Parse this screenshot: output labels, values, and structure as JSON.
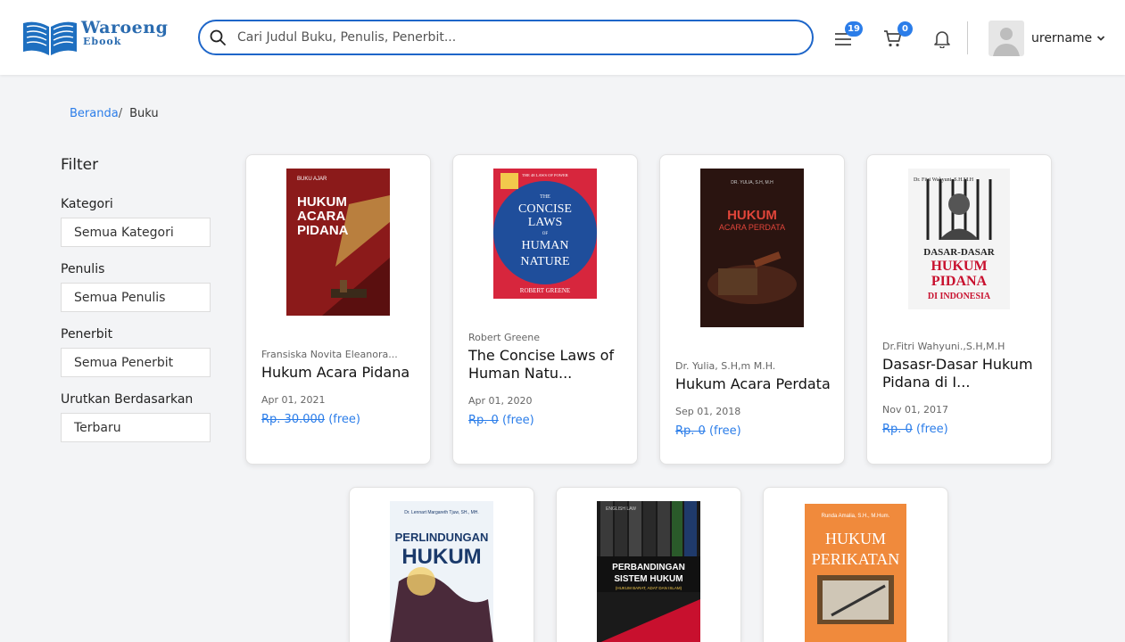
{
  "header": {
    "logo_line1": "Waroeng",
    "logo_line2": "Ebook",
    "search_placeholder": "Cari Judul Buku, Penulis, Penerbit...",
    "list_badge": "19",
    "cart_badge": "0",
    "username": "urername"
  },
  "breadcrumb": {
    "home": "Beranda",
    "separator": "/",
    "current": "Buku"
  },
  "filter": {
    "title": "Filter",
    "category_label": "Kategori",
    "category_value": "Semua Kategori",
    "author_label": "Penulis",
    "author_value": "Semua Penulis",
    "publisher_label": "Penerbit",
    "publisher_value": "Semua Penerbit",
    "sort_label": "Urutkan Berdasarkan",
    "sort_value": "Terbaru"
  },
  "books": [
    {
      "author": "Fransiska Novita Eleanora...",
      "title": "Hukum Acara Pidana",
      "date": "Apr 01, 2021",
      "price_old": "Rp. 30.000",
      "price_new": "(free)",
      "cover": {
        "bg": "#8b1a1a",
        "accent": "#c8a24b",
        "fg": "#ffffff",
        "top": "BUKU AJAR",
        "lines": [
          "HUKUM",
          "ACARA",
          "PIDANA"
        ]
      }
    },
    {
      "author": "Robert Greene",
      "title": "The Concise Laws of Human Natu...",
      "date": "Apr 01, 2020",
      "price_old": "Rp. 0",
      "price_new": "(free)",
      "cover": {
        "bg": "#d7263d",
        "accent": "#1f4e9b",
        "fg": "#ffffff",
        "top": "THE 48 LAWS OF POWER",
        "lines": [
          "THE",
          "CONCISE",
          "LAWS",
          "OF",
          "HUMAN",
          "NATURE"
        ],
        "bottom": "ROBERT GREENE"
      }
    },
    {
      "author": "Dr. Yulia, S.H,m M.H.",
      "title": "Hukum Acara Perdata",
      "date": "Sep 01, 2018",
      "price_old": "Rp. 0",
      "price_new": "(free)",
      "cover": {
        "bg": "#2a1410",
        "accent": "#b23a2a",
        "fg": "#e0453a",
        "top": "DR. YULIA, S.H, M.H",
        "lines": [
          "HUKUM",
          "ACARA PERDATA"
        ]
      }
    },
    {
      "author": "Dr.Fitri Wahyuni.,S.H,M.H",
      "title": "Dasasr-Dasar Hukum Pidana di I...",
      "date": "Nov 01, 2017",
      "price_old": "Rp. 0",
      "price_new": "(free)",
      "cover": {
        "bg": "#f4f4f4",
        "accent": "#222222",
        "fg": "#c8102e",
        "top": "Dr. Fitri Wahyuni, S.H.M.H",
        "lines": [
          "DASAR-DASAR",
          "HUKUM",
          "PIDANA",
          "DI INDONESIA"
        ]
      }
    },
    {
      "cover": {
        "bg": "#eef3f8",
        "accent": "#1b3a6b",
        "fg": "#1b3a6b",
        "top": "Dr. Lennart Margareth Tjuw, SH., MH.",
        "lines": [
          "PERLINDUNGAN",
          "HUKUM"
        ]
      }
    },
    {
      "cover": {
        "bg": "#1a1a1a",
        "accent": "#c8102e",
        "fg": "#ffffff",
        "top": "ENGLISH LAW",
        "lines": [
          "PERBANDINGAN",
          "SISTEM HUKUM",
          "(HUKUM BARAT, ADAT DAN ISLAM)"
        ]
      }
    },
    {
      "cover": {
        "bg": "#f08a3c",
        "accent": "#6a4a2a",
        "fg": "#ffffff",
        "top": "Runda Amalia, S.H., M.Hum.",
        "lines": [
          "HUKUM",
          "PERIKATAN"
        ]
      }
    }
  ]
}
